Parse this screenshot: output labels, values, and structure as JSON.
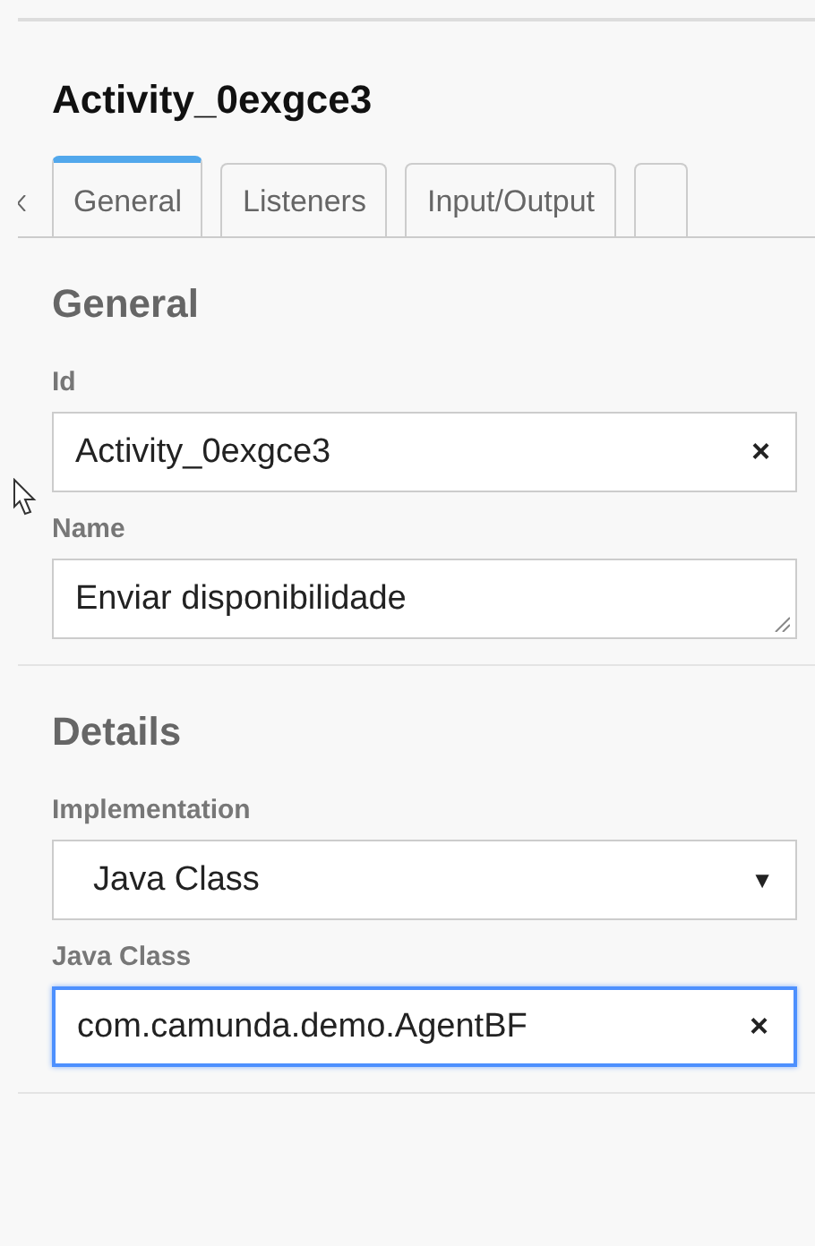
{
  "panel": {
    "title": "Activity_0exgce3",
    "tabs": [
      {
        "label": "General",
        "selected": true
      },
      {
        "label": "Listeners",
        "selected": false
      },
      {
        "label": "Input/Output",
        "selected": false
      }
    ],
    "sections": [
      {
        "heading": "General",
        "fields": [
          {
            "kind": "text",
            "label": "Id",
            "value": "Activity_0exgce3",
            "clear": "×",
            "focused": false
          },
          {
            "kind": "textarea",
            "label": "Name",
            "value": "Enviar disponibilidade"
          }
        ]
      },
      {
        "heading": "Details",
        "fields": [
          {
            "kind": "select",
            "label": "Implementation",
            "value": "Java Class",
            "caret": "▼"
          },
          {
            "kind": "text",
            "label": "Java Class",
            "value": "com.camunda.demo.AgentBF",
            "clear": "×",
            "focused": true
          }
        ]
      }
    ]
  }
}
